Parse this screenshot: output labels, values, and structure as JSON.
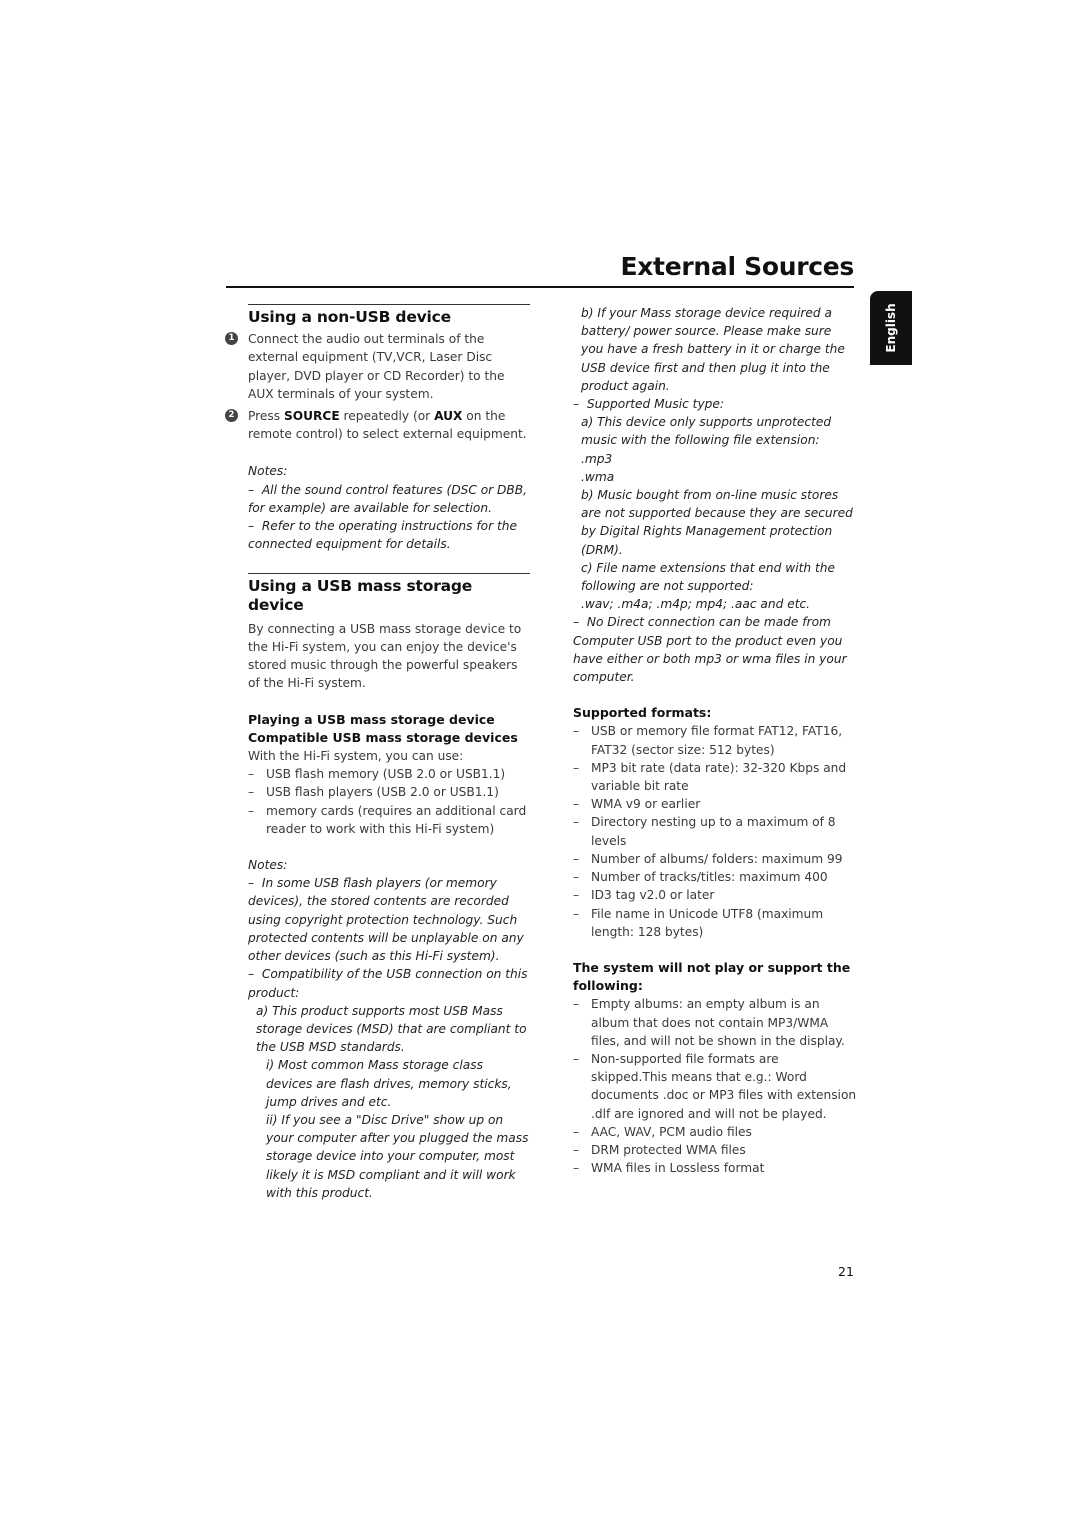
{
  "header": {
    "title": "External Sources"
  },
  "language_tab": "English",
  "page_number": "21",
  "left": {
    "section1": {
      "title": "Using a non-USB device",
      "steps": [
        {
          "num": "1",
          "text": "Connect the audio out terminals of the external equipment (TV,VCR, Laser Disc player, DVD player or CD Recorder) to the AUX terminals of your system."
        },
        {
          "num": "2",
          "pre": "Press ",
          "bold1": "SOURCE",
          "mid": " repeatedly (or ",
          "bold2": "AUX",
          "post": " on the remote control) to select external equipment."
        }
      ],
      "notes_label": "Notes:",
      "notes": [
        "All the sound control features (DSC or DBB, for example) are available for selection.",
        "Refer to the operating instructions for the connected equipment for details."
      ]
    },
    "section2": {
      "title": "Using a USB mass storage device",
      "intro": "By connecting a USB mass storage device to the Hi-Fi system, you can enjoy the device's stored music through the powerful speakers of the Hi-Fi system.",
      "subhead1": "Playing a USB mass storage device",
      "subhead2": "Compatible USB mass storage devices",
      "lead": "With the Hi-Fi system, you can use:",
      "items": [
        "USB flash memory (USB 2.0 or USB1.1)",
        "USB flash players (USB 2.0 or USB1.1)",
        "memory cards (requires an additional card reader to work with this Hi-Fi system)"
      ],
      "notes_label": "Notes:",
      "note1": "In some USB flash players (or memory devices), the stored contents are recorded using copyright protection technology. Such protected contents will be unplayable on any other devices (such as this Hi-Fi system).",
      "note2": "Compatibility of the USB connection on this product:",
      "note2a": "a) This product supports most USB Mass storage devices (MSD) that are compliant to the USB MSD standards.",
      "note2a_i": "i) Most common Mass storage class devices are flash drives, memory sticks, jump drives and etc.",
      "note2a_ii": "ii) If you see a \"Disc Drive\" show up on your computer after you plugged the mass storage device into your computer, most likely it is MSD compliant and it will work with this product."
    }
  },
  "right": {
    "note2b": "b) If your Mass storage device required a battery/ power source. Please make sure you have a fresh battery in it or charge the USB device first and then plug it into the product again.",
    "music_type": "Supported Music type:",
    "music_a": "a) This device only supports unprotected music with the following file extension:",
    "ext1": ".mp3",
    "ext2": ".wma",
    "music_b": "b) Music bought from on-line music stores are not supported because they are secured by Digital Rights Management protection (DRM).",
    "music_c": "c) File name extensions that end with the following are not supported:",
    "unsupported_ext": ".wav; .m4a; .m4p; mp4; .aac and etc.",
    "no_direct": "No Direct connection can be made from Computer USB port to the product even you have either or both mp3 or wma files in your computer.",
    "formats_title": "Supported formats:",
    "formats": [
      "USB or memory file format FAT12, FAT16, FAT32 (sector size: 512 bytes)",
      "MP3 bit rate (data rate): 32-320 Kbps and variable bit rate",
      "WMA v9 or earlier",
      "Directory nesting up to a maximum of 8 levels",
      "Number of albums/ folders: maximum 99",
      "Number of tracks/titles: maximum 400",
      "ID3 tag v2.0 or later",
      "File name in Unicode UTF8 (maximum length: 128 bytes)"
    ],
    "unsupported_title": "The system will not play or support the following:",
    "unsupported": [
      "Empty albums: an empty album is an album that does not contain MP3/WMA files, and will not be shown in the display.",
      "Non-supported file formats are skipped.This means that e.g.: Word documents .doc or MP3 files with extension .dlf are ignored and will not be played.",
      "AAC, WAV, PCM audio files",
      "DRM protected WMA files",
      "WMA files in Lossless format"
    ],
    "dash": "–"
  }
}
